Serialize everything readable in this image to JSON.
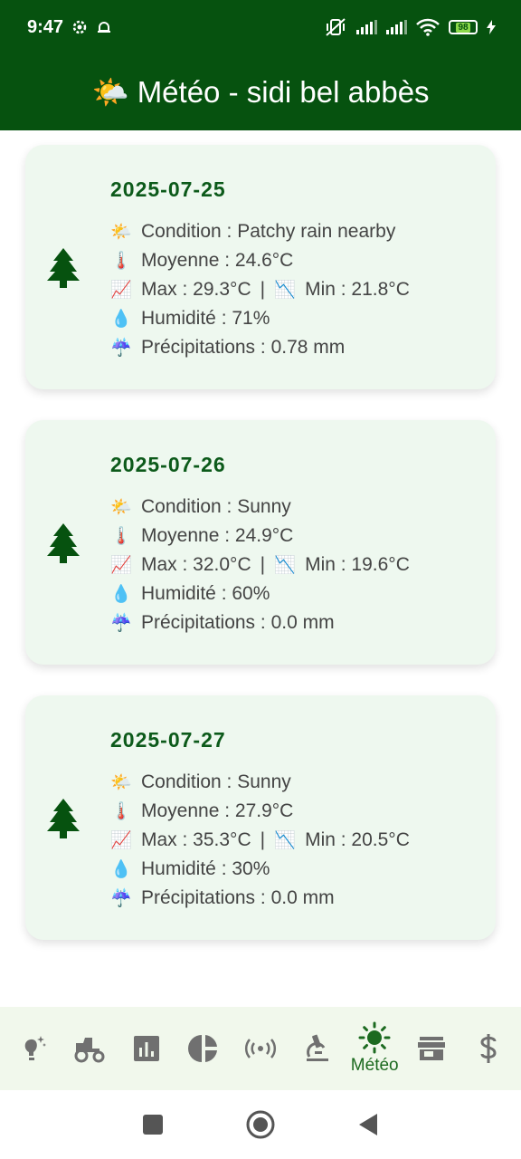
{
  "status": {
    "time": "9:47",
    "battery": "98"
  },
  "header": {
    "icon": "sun-behind-cloud-emoji",
    "title": "🌤️ Météo - sidi bel abbès"
  },
  "colors": {
    "primary": "#06520f",
    "card_bg": "#eef8ef",
    "date_green": "#0c5a1a",
    "nav_bg": "#f1f8ec"
  },
  "forecasts": [
    {
      "date": "2025-07-25",
      "condition": "Condition : Patchy rain nearby",
      "moyenne": "Moyenne : 24.6°C",
      "max": "Max : 29.3°C",
      "sep": "|",
      "min": "Min : 21.8°C",
      "humidite": "Humidité : 71%",
      "precipitations": "Précipitations : 0.78 mm"
    },
    {
      "date": "2025-07-26",
      "condition": "Condition : Sunny",
      "moyenne": "Moyenne : 24.9°C",
      "max": "Max : 32.0°C",
      "sep": "|",
      "min": "Min : 19.6°C",
      "humidite": "Humidité : 60%",
      "precipitations": "Précipitations : 0.0 mm"
    },
    {
      "date": "2025-07-27",
      "condition": "Condition : Sunny",
      "moyenne": "Moyenne : 27.9°C",
      "max": "Max : 35.3°C",
      "sep": "|",
      "min": "Min : 20.5°C",
      "humidite": "Humidité : 30%",
      "precipitations": "Précipitations : 0.0 mm"
    }
  ],
  "emojis": {
    "condition": "🌤️",
    "moyenne": "🌡️",
    "max": "📈",
    "min": "📉",
    "humidite": "💧",
    "precipitations": "☔"
  },
  "nav": {
    "items": [
      {
        "name": "lightbulb-icon"
      },
      {
        "name": "tractor-icon"
      },
      {
        "name": "bar-chart-icon"
      },
      {
        "name": "pie-chart-icon"
      },
      {
        "name": "sensor-signal-icon"
      },
      {
        "name": "microscope-icon"
      },
      {
        "name": "sun-icon",
        "label": "Météo",
        "active": true
      },
      {
        "name": "store-icon"
      },
      {
        "name": "dollar-icon"
      }
    ]
  }
}
